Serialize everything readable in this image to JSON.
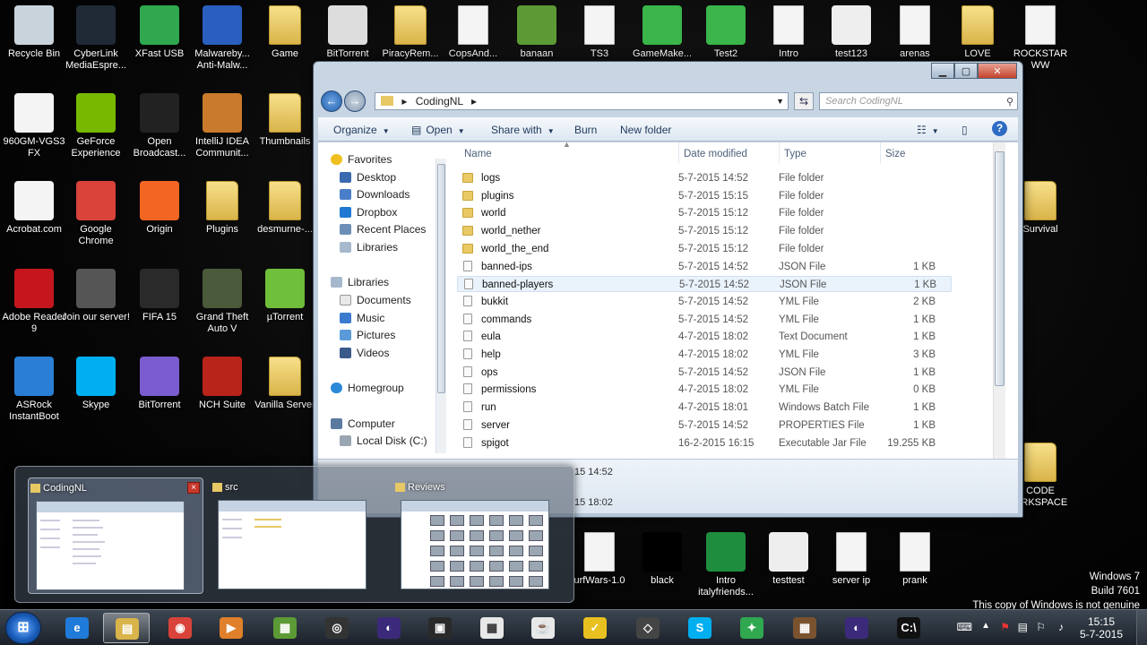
{
  "desktop": {
    "icons": [
      {
        "label": "Recycle Bin",
        "icon": "recycle-bin-icon",
        "color": "#c9d3dc"
      },
      {
        "label": "CyberLink MediaEspre...",
        "icon": "cyberlink-icon",
        "color": "#1f2a36"
      },
      {
        "label": "XFast USB",
        "icon": "xfast-usb-icon",
        "color": "#2fa84f"
      },
      {
        "label": "Malwareby... Anti-Malw...",
        "icon": "malwarebytes-icon",
        "color": "#2a5fbf"
      },
      {
        "label": "Game",
        "icon": "folder-icon",
        "color": "#e6c865"
      },
      {
        "label": "BitTorrent",
        "icon": "bittorrent-icon",
        "color": "#dddddd"
      },
      {
        "label": "PiracyRem...",
        "icon": "folder-icon",
        "color": "#e6c865"
      },
      {
        "label": "CopsAnd...",
        "icon": "document-icon",
        "color": "#f4f4f4"
      },
      {
        "label": "banaan",
        "icon": "minecraft-icon",
        "color": "#5c9a35"
      },
      {
        "label": "TS3",
        "icon": "document-icon",
        "color": "#f4f4f4"
      },
      {
        "label": "GameMake...",
        "icon": "gamemaker-icon",
        "color": "#39b54a"
      },
      {
        "label": "Test2",
        "icon": "gamemaker-icon",
        "color": "#39b54a"
      },
      {
        "label": "Intro",
        "icon": "document-icon",
        "color": "#f4f4f4"
      },
      {
        "label": "test123",
        "icon": "image-icon",
        "color": "#eeeeee"
      },
      {
        "label": "arenas",
        "icon": "document-icon",
        "color": "#f4f4f4"
      },
      {
        "label": "LOVE",
        "icon": "folder-icon",
        "color": "#e6c865"
      },
      {
        "label": "ROCKSTAR WW",
        "icon": "document-icon",
        "color": "#f4f4f4"
      },
      {
        "label": "960GM-VGS3 FX",
        "icon": "pdf-icon",
        "color": "#f4f4f4"
      },
      {
        "label": "GeForce Experience",
        "icon": "nvidia-icon",
        "color": "#76b900"
      },
      {
        "label": "Open Broadcast...",
        "icon": "obs-icon",
        "color": "#222222"
      },
      {
        "label": "IntelliJ IDEA Communit...",
        "icon": "intellij-icon",
        "color": "#c97a2c"
      },
      {
        "label": "Thumbnails",
        "icon": "folder-icon",
        "color": "#e6c865"
      },
      {
        "label": "Acrobat.com",
        "icon": "acrobat-icon",
        "color": "#f4f4f4"
      },
      {
        "label": "Google Chrome",
        "icon": "chrome-icon",
        "color": "#d9433a"
      },
      {
        "label": "Origin",
        "icon": "origin-icon",
        "color": "#f26522"
      },
      {
        "label": "Plugins",
        "icon": "folder-icon",
        "color": "#e6c865"
      },
      {
        "label": "desmurne-...",
        "icon": "folder-icon",
        "color": "#e6c865"
      },
      {
        "label": "Survival",
        "icon": "folder-icon",
        "color": "#e6c865"
      },
      {
        "label": "Adobe Reader 9",
        "icon": "adobe-reader-icon",
        "color": "#c4161c"
      },
      {
        "label": "Join our server!",
        "icon": "minecraft-icon",
        "color": "#555555"
      },
      {
        "label": "FIFA 15",
        "icon": "fifa-icon",
        "color": "#2a2a2a"
      },
      {
        "label": "Grand Theft Auto V",
        "icon": "gta-icon",
        "color": "#4a5a3a"
      },
      {
        "label": "µTorrent",
        "icon": "utorrent-icon",
        "color": "#6fbf3a"
      },
      {
        "label": "ASRock InstantBoot",
        "icon": "asrock-icon",
        "color": "#2a7fd4"
      },
      {
        "label": "Skype",
        "icon": "skype-icon",
        "color": "#00aff0"
      },
      {
        "label": "BitTorrent",
        "icon": "bittorrent-icon",
        "color": "#7a5ccf"
      },
      {
        "label": "NCH Suite",
        "icon": "nch-icon",
        "color": "#b8231a"
      },
      {
        "label": "Vanilla Server",
        "icon": "folder-icon",
        "color": "#e6c865"
      },
      {
        "label": "CODE ORKSPACE",
        "icon": "folder-icon",
        "color": "#e6c865"
      },
      {
        "label": "urfWars-1.0",
        "icon": "document-icon",
        "color": "#f4f4f4"
      },
      {
        "label": "black",
        "icon": "image-icon",
        "color": "#000000"
      },
      {
        "label": "Intro italyfriends...",
        "icon": "image-icon",
        "color": "#1e8e3e"
      },
      {
        "label": "testtest",
        "icon": "image-icon",
        "color": "#eeeeee"
      },
      {
        "label": "server ip",
        "icon": "document-icon",
        "color": "#f4f4f4"
      },
      {
        "label": "prank",
        "icon": "document-icon",
        "color": "#f4f4f4"
      }
    ]
  },
  "explorer": {
    "breadcrumb": "CodingNL",
    "search_placeholder": "Search CodingNL",
    "toolbar": {
      "organize": "Organize",
      "open": "Open",
      "share_with": "Share with",
      "burn": "Burn",
      "new_folder": "New folder"
    },
    "columns": {
      "name": "Name",
      "date": "Date modified",
      "type": "Type",
      "size": "Size"
    },
    "nav": {
      "favorites": "Favorites",
      "desktop": "Desktop",
      "downloads": "Downloads",
      "dropbox": "Dropbox",
      "recent_places": "Recent Places",
      "libraries_fav": "Libraries",
      "libraries": "Libraries",
      "documents": "Documents",
      "music": "Music",
      "pictures": "Pictures",
      "videos": "Videos",
      "homegroup": "Homegroup",
      "computer": "Computer",
      "local_disk": "Local Disk (C:)"
    },
    "files": [
      {
        "name": "logs",
        "date": "5-7-2015 14:52",
        "type": "File folder",
        "size": "",
        "kind": "folder"
      },
      {
        "name": "plugins",
        "date": "5-7-2015 15:15",
        "type": "File folder",
        "size": "",
        "kind": "folder"
      },
      {
        "name": "world",
        "date": "5-7-2015 15:12",
        "type": "File folder",
        "size": "",
        "kind": "folder"
      },
      {
        "name": "world_nether",
        "date": "5-7-2015 15:12",
        "type": "File folder",
        "size": "",
        "kind": "folder"
      },
      {
        "name": "world_the_end",
        "date": "5-7-2015 15:12",
        "type": "File folder",
        "size": "",
        "kind": "folder"
      },
      {
        "name": "banned-ips",
        "date": "5-7-2015 14:52",
        "type": "JSON File",
        "size": "1 KB",
        "kind": "file"
      },
      {
        "name": "banned-players",
        "date": "5-7-2015 14:52",
        "type": "JSON File",
        "size": "1 KB",
        "kind": "file",
        "selected": true
      },
      {
        "name": "bukkit",
        "date": "5-7-2015 14:52",
        "type": "YML File",
        "size": "2 KB",
        "kind": "file"
      },
      {
        "name": "commands",
        "date": "5-7-2015 14:52",
        "type": "YML File",
        "size": "1 KB",
        "kind": "file"
      },
      {
        "name": "eula",
        "date": "4-7-2015 18:02",
        "type": "Text Document",
        "size": "1 KB",
        "kind": "file"
      },
      {
        "name": "help",
        "date": "4-7-2015 18:02",
        "type": "YML File",
        "size": "3 KB",
        "kind": "file"
      },
      {
        "name": "ops",
        "date": "5-7-2015 14:52",
        "type": "JSON File",
        "size": "1 KB",
        "kind": "file"
      },
      {
        "name": "permissions",
        "date": "4-7-2015 18:02",
        "type": "YML File",
        "size": "0 KB",
        "kind": "file"
      },
      {
        "name": "run",
        "date": "4-7-2015 18:01",
        "type": "Windows Batch File",
        "size": "1 KB",
        "kind": "file"
      },
      {
        "name": "server",
        "date": "5-7-2015 14:52",
        "type": "PROPERTIES File",
        "size": "1 KB",
        "kind": "file"
      },
      {
        "name": "spigot",
        "date": "16-2-2015 16:15",
        "type": "Executable Jar File",
        "size": "19.255 KB",
        "kind": "file"
      }
    ],
    "details": {
      "line1": "15 14:52",
      "line2": "15 18:02"
    }
  },
  "preview": {
    "items": [
      {
        "title": "CodingNL",
        "close": "×"
      },
      {
        "title": "src"
      },
      {
        "title": "Reviews"
      }
    ]
  },
  "taskbar": {
    "start": "⊞",
    "apps": [
      {
        "name": "internet-explorer-icon",
        "glyph": "e",
        "color": "#1f7ad9"
      },
      {
        "name": "file-explorer-icon",
        "glyph": "▤",
        "color": "#d9b44a"
      },
      {
        "name": "chrome-icon",
        "glyph": "◉",
        "color": "#d9433a"
      },
      {
        "name": "media-player-icon",
        "glyph": "▶",
        "color": "#e0802a"
      },
      {
        "name": "minecraft-icon",
        "glyph": "▦",
        "color": "#5c9a35"
      },
      {
        "name": "obs-icon",
        "glyph": "◎",
        "color": "#333333"
      },
      {
        "name": "eclipse-icon",
        "glyph": "◐",
        "color": "#3b2a7a"
      },
      {
        "name": "film-icon",
        "glyph": "▣",
        "color": "#2a2a2a"
      },
      {
        "name": "apps-grid-icon",
        "glyph": "▦",
        "color": "#e8e8e8"
      },
      {
        "name": "java-icon",
        "glyph": "☕",
        "color": "#e8e8e8"
      },
      {
        "name": "norton-icon",
        "glyph": "✓",
        "color": "#e8c020"
      },
      {
        "name": "unity-icon",
        "glyph": "◇",
        "color": "#444444"
      },
      {
        "name": "skype-icon",
        "glyph": "S",
        "color": "#00aff0"
      },
      {
        "name": "xfast-icon",
        "glyph": "✦",
        "color": "#2fa84f"
      },
      {
        "name": "minecraft-server-icon",
        "glyph": "▦",
        "color": "#7a5230"
      },
      {
        "name": "eclipse-workspace-icon",
        "glyph": "◐",
        "color": "#3b2a7a"
      },
      {
        "name": "cmd-icon",
        "glyph": "C:\\",
        "color": "#111111"
      }
    ],
    "clock_time": "15:15",
    "clock_date": "5-7-2015",
    "tray_icons": [
      "keyboard-icon",
      "chevron-up-icon",
      "network-warning-icon",
      "flag-icon",
      "volume-icon",
      "show-desktop-icon"
    ]
  },
  "watermark": {
    "line1": "Windows 7",
    "line2": "Build 7601",
    "line3": "This copy of Windows is not genuine"
  }
}
